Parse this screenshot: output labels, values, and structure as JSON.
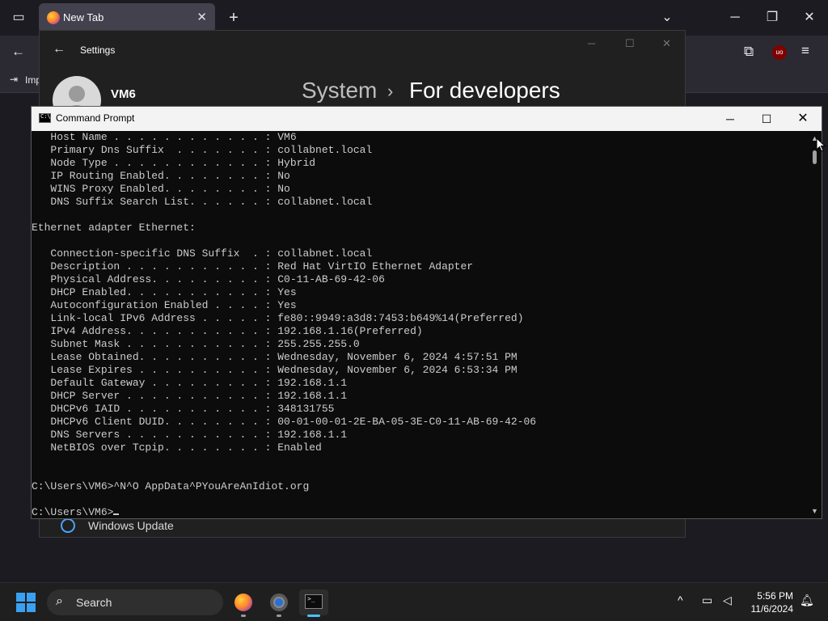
{
  "browser": {
    "tab_title": "New Tab",
    "tab_close": "✕",
    "new_tab": "+",
    "bookmark_label": "Imp",
    "extension_badge": "uo"
  },
  "settings": {
    "title": "Settings",
    "user_name": "VM6",
    "breadcrumb_parent": "System",
    "breadcrumb_separator": "›",
    "breadcrumb_current": "For developers",
    "windows_update_label": "Windows Update"
  },
  "cmd": {
    "title": "Command Prompt",
    "lines": [
      "   Host Name . . . . . . . . . . . . : VM6",
      "   Primary Dns Suffix  . . . . . . . : collabnet.local",
      "   Node Type . . . . . . . . . . . . : Hybrid",
      "   IP Routing Enabled. . . . . . . . : No",
      "   WINS Proxy Enabled. . . . . . . . : No",
      "   DNS Suffix Search List. . . . . . : collabnet.local",
      "",
      "Ethernet adapter Ethernet:",
      "",
      "   Connection-specific DNS Suffix  . : collabnet.local",
      "   Description . . . . . . . . . . . : Red Hat VirtIO Ethernet Adapter",
      "   Physical Address. . . . . . . . . : C0-11-AB-69-42-06",
      "   DHCP Enabled. . . . . . . . . . . : Yes",
      "   Autoconfiguration Enabled . . . . : Yes",
      "   Link-local IPv6 Address . . . . . : fe80::9949:a3d8:7453:b649%14(Preferred)",
      "   IPv4 Address. . . . . . . . . . . : 192.168.1.16(Preferred)",
      "   Subnet Mask . . . . . . . . . . . : 255.255.255.0",
      "   Lease Obtained. . . . . . . . . . : Wednesday, November 6, 2024 4:57:51 PM",
      "   Lease Expires . . . . . . . . . . : Wednesday, November 6, 2024 6:53:34 PM",
      "   Default Gateway . . . . . . . . . : 192.168.1.1",
      "   DHCP Server . . . . . . . . . . . : 192.168.1.1",
      "   DHCPv6 IAID . . . . . . . . . . . : 348131755",
      "   DHCPv6 Client DUID. . . . . . . . : 00-01-00-01-2E-BA-05-3E-C0-11-AB-69-42-06",
      "   DNS Servers . . . . . . . . . . . : 192.168.1.1",
      "   NetBIOS over Tcpip. . . . . . . . : Enabled",
      "",
      "",
      "C:\\Users\\VM6>^N^O AppData^PYouAreAnIdiot.org",
      ""
    ],
    "prompt": "C:\\Users\\VM6>"
  },
  "taskbar": {
    "search_label": "Search",
    "time": "5:56 PM",
    "date": "11/6/2024"
  },
  "icons": {
    "minimize": "─",
    "maximize": "☐",
    "close": "✕",
    "back": "←",
    "chevron_up": "^"
  }
}
